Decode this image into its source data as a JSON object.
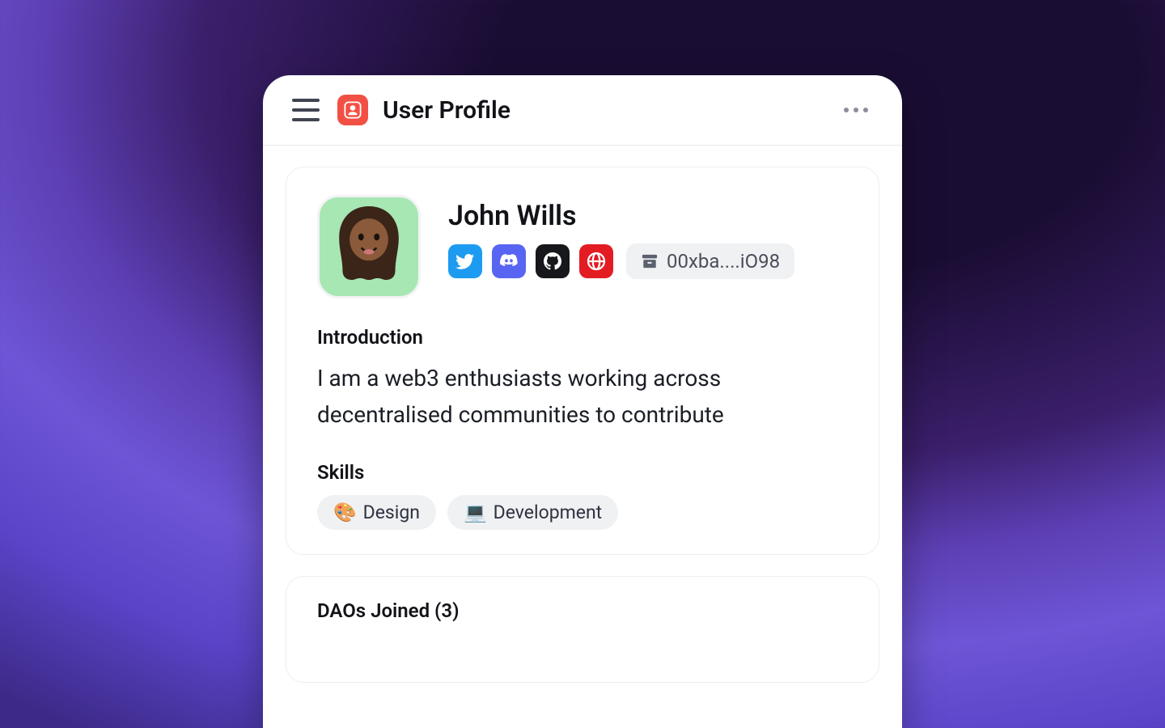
{
  "header": {
    "title": "User Profile"
  },
  "profile": {
    "name": "John Wills",
    "wallet": "00xba....iO98"
  },
  "sections": {
    "introduction": {
      "heading": "Introduction",
      "body": "I am a web3 enthusiasts working across decentralised communities to contribute"
    },
    "skills": {
      "heading": "Skills",
      "items": [
        {
          "emoji": "🎨",
          "label": "Design"
        },
        {
          "emoji": "💻",
          "label": "Development"
        }
      ]
    },
    "daos": {
      "heading": "DAOs Joined (3)"
    }
  }
}
